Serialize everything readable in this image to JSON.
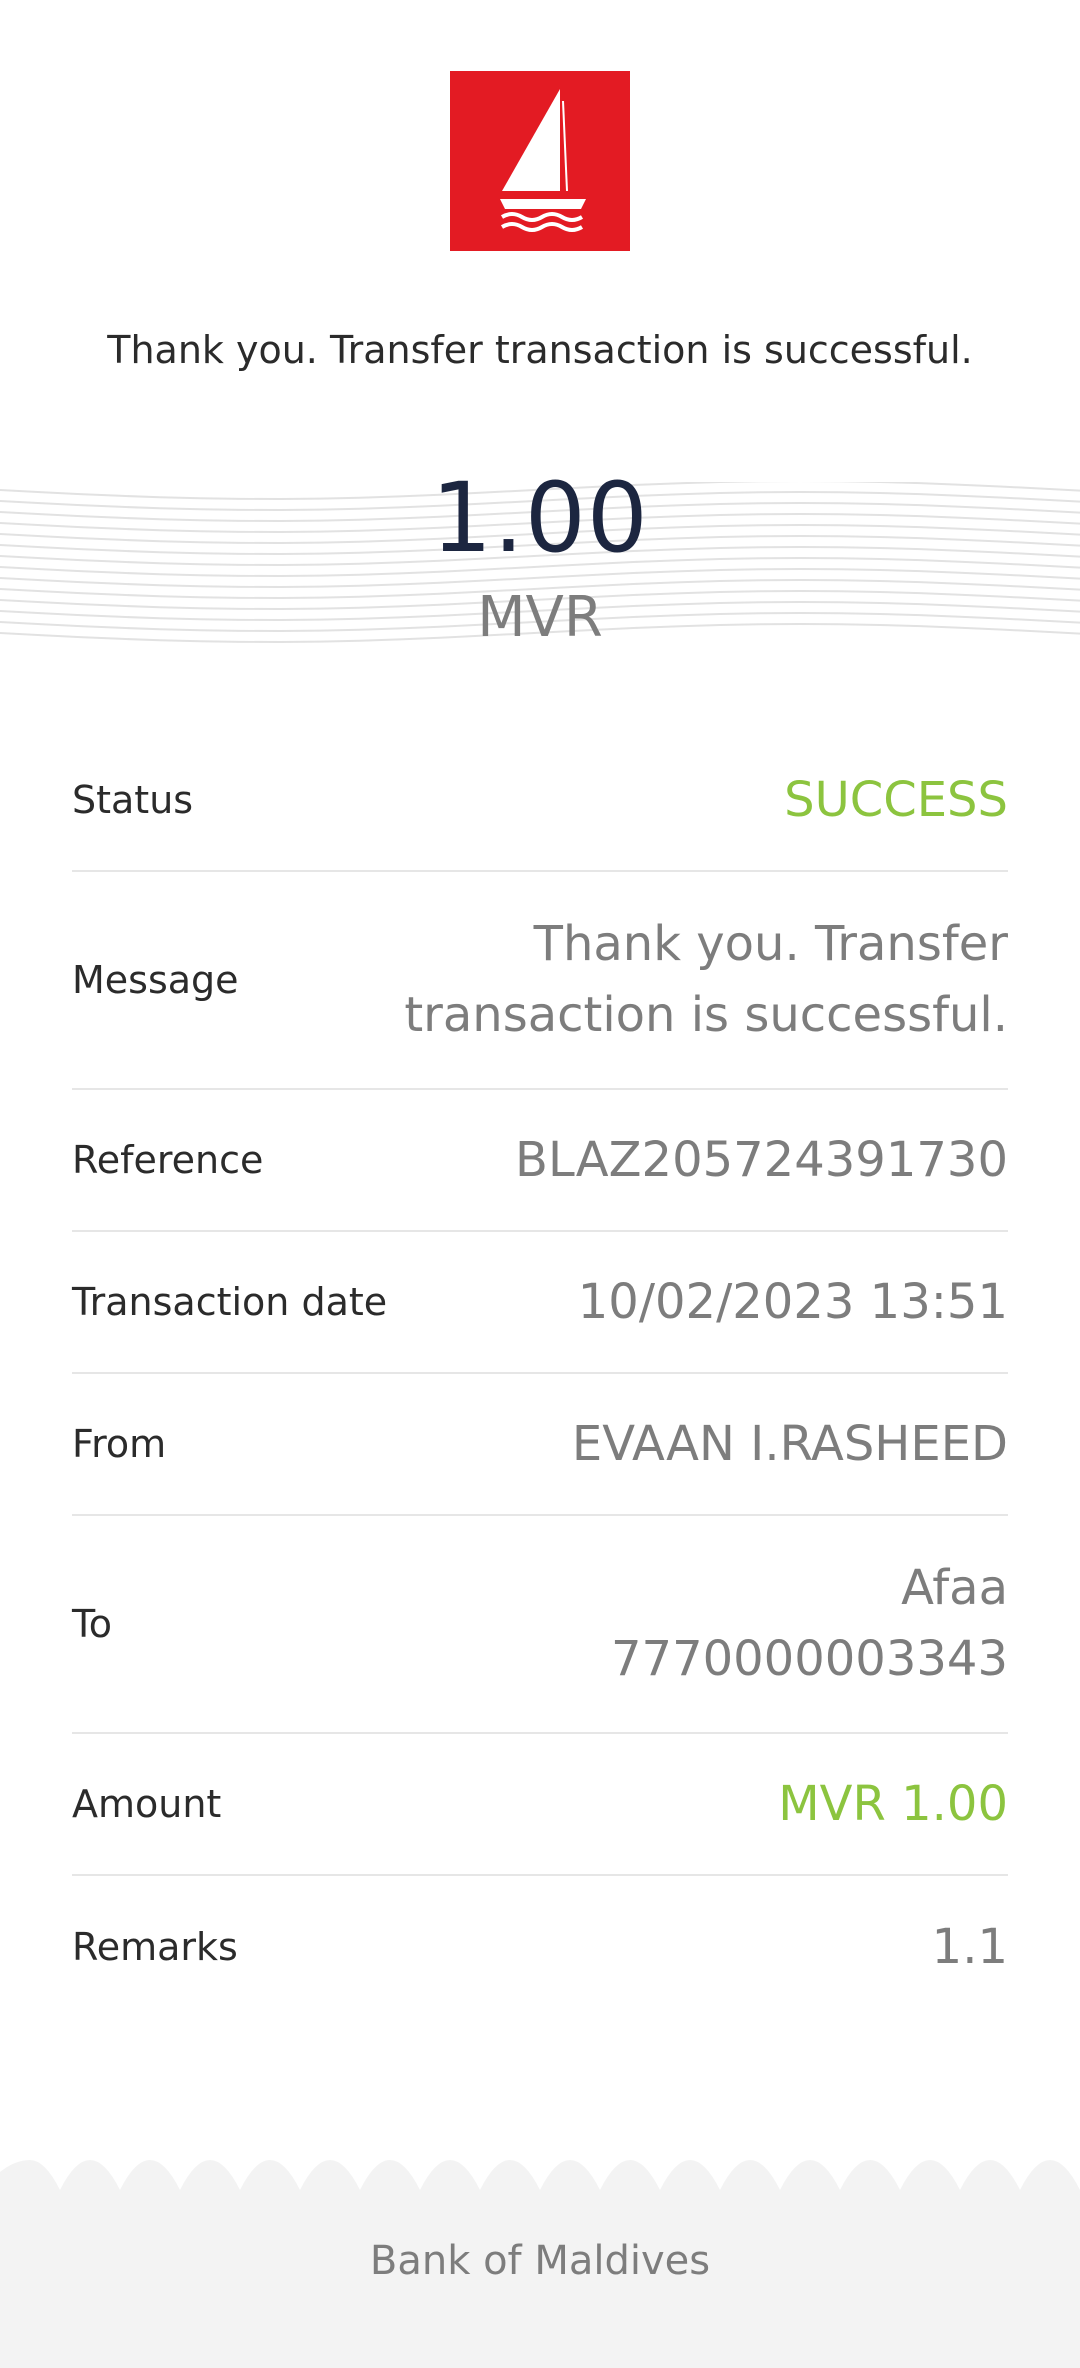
{
  "brand": {
    "logo_icon": "sailboat-icon",
    "logo_color": "#e31b23"
  },
  "confirmation_message": "Thank you. Transfer transaction is successful.",
  "summary": {
    "amount": "1.00",
    "currency": "MVR"
  },
  "details": [
    {
      "label": "Status",
      "value": "SUCCESS"
    },
    {
      "label": "Message",
      "value": "Thank you. Transfer transaction is successful."
    },
    {
      "label": "Reference",
      "value": "BLAZ205724391730"
    },
    {
      "label": "Transaction date",
      "value": "10/02/2023 13:51"
    },
    {
      "label": "From",
      "value": "EVAAN I.RASHEED"
    },
    {
      "label": "To",
      "value": "Afaa 7770000003343"
    },
    {
      "label": "Amount",
      "value": "MVR 1.00"
    },
    {
      "label": "Remarks",
      "value": "1.1"
    }
  ],
  "footer": {
    "bank_name": "Bank of Maldives"
  },
  "colors": {
    "success_green": "#8cc43f",
    "amount_navy": "#1c2640"
  }
}
